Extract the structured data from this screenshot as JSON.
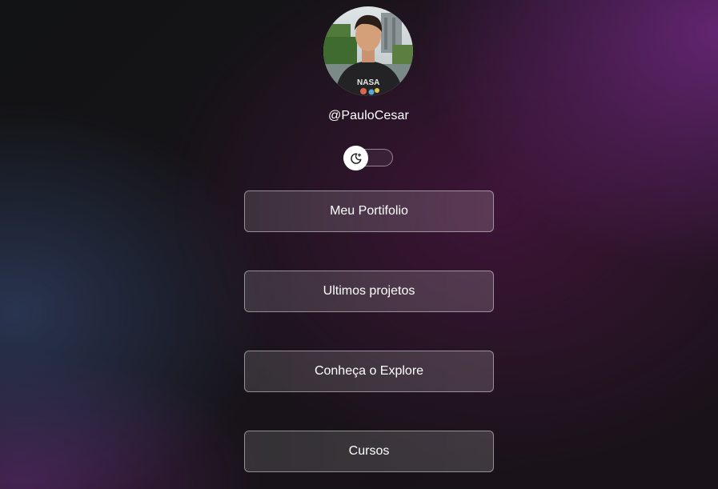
{
  "profile": {
    "username": "@PauloCesar",
    "avatar_icon": "profile-photo",
    "shirt_text": "NASA"
  },
  "theme_toggle": {
    "icon": "moon-stars-icon",
    "state": "off"
  },
  "links": [
    {
      "label": "Meu Portifolio"
    },
    {
      "label": "Ultimos projetos"
    },
    {
      "label": "Conheça o Explore"
    },
    {
      "label": "Cursos"
    }
  ],
  "colors": {
    "background": "#141216",
    "accent_purple": "#702880",
    "accent_blue": "#3a5080",
    "text": "#ffffff"
  }
}
